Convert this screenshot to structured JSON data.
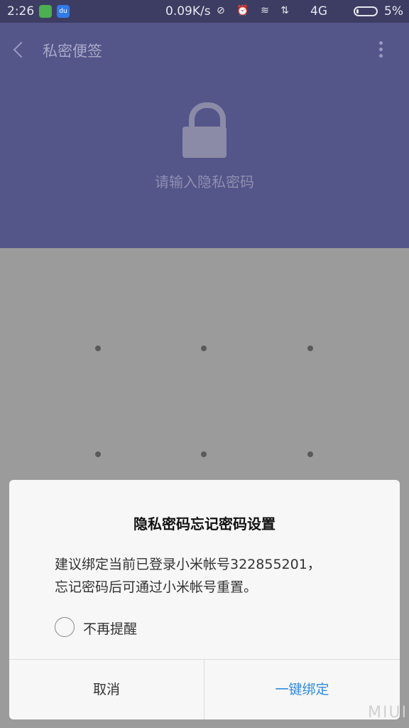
{
  "status_bar": {
    "time": "2:26",
    "speed": "0.09K/s",
    "icons": "⊘ ⏰ ≋ ⇅",
    "network": "4G",
    "battery": "5%"
  },
  "header": {
    "title": "私密便签",
    "prompt": "请输入隐私密码"
  },
  "dialog": {
    "title": "隐私密码忘记密码设置",
    "message_line1": "建议绑定当前已登录小米帐号322855201，",
    "message_line2": "忘记密码后可通过小米帐号重置。",
    "remind_label": "不再提醒",
    "cancel_label": "取消",
    "bind_label": "一键绑定"
  },
  "watermark": "MIUI",
  "colors": {
    "header_bg": "#545589",
    "overlay_bg": "#9b9b9b",
    "accent": "#2f8be0"
  }
}
